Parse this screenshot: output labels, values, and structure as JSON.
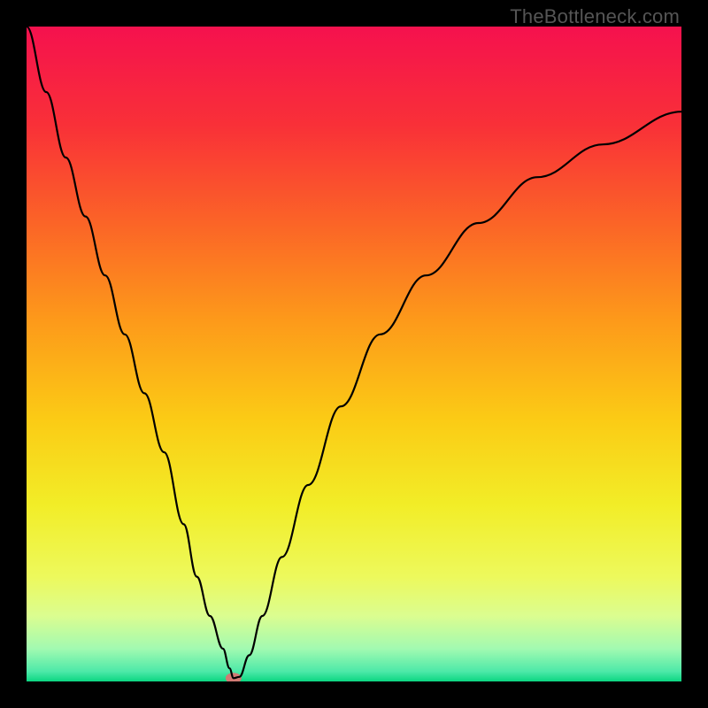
{
  "watermark": "TheBottleneck.com",
  "chart_data": {
    "type": "line",
    "title": "",
    "xlabel": "",
    "ylabel": "",
    "xlim": [
      0,
      100
    ],
    "ylim": [
      0,
      100
    ],
    "grid": false,
    "legend": false,
    "background": {
      "type": "vertical-gradient",
      "stops": [
        {
          "pos": 0.0,
          "color": "#f5114e"
        },
        {
          "pos": 0.15,
          "color": "#f93038"
        },
        {
          "pos": 0.3,
          "color": "#fb6427"
        },
        {
          "pos": 0.45,
          "color": "#fd9a1a"
        },
        {
          "pos": 0.6,
          "color": "#fbcb15"
        },
        {
          "pos": 0.73,
          "color": "#f2ed27"
        },
        {
          "pos": 0.84,
          "color": "#edf95c"
        },
        {
          "pos": 0.9,
          "color": "#dbfd90"
        },
        {
          "pos": 0.95,
          "color": "#a2fab1"
        },
        {
          "pos": 0.985,
          "color": "#4ce9a8"
        },
        {
          "pos": 1.0,
          "color": "#0bd681"
        }
      ]
    },
    "series": [
      {
        "name": "bottleneck-curve",
        "color": "#000000",
        "x": [
          0,
          3,
          6,
          9,
          12,
          15,
          18,
          21,
          24,
          26,
          28,
          30,
          31,
          31.6,
          32.5,
          34,
          36,
          39,
          43,
          48,
          54,
          61,
          69,
          78,
          88,
          100
        ],
        "y": [
          100,
          90,
          80,
          71,
          62,
          53,
          44,
          35,
          24,
          16,
          10,
          5,
          2,
          0.5,
          0.7,
          4,
          10,
          19,
          30,
          42,
          53,
          62,
          70,
          77,
          82,
          87
        ]
      }
    ],
    "marker": {
      "name": "min-point-marker",
      "x": 31.6,
      "y": 0.5,
      "color": "#d07a74",
      "rx": 9,
      "ry": 6
    }
  }
}
